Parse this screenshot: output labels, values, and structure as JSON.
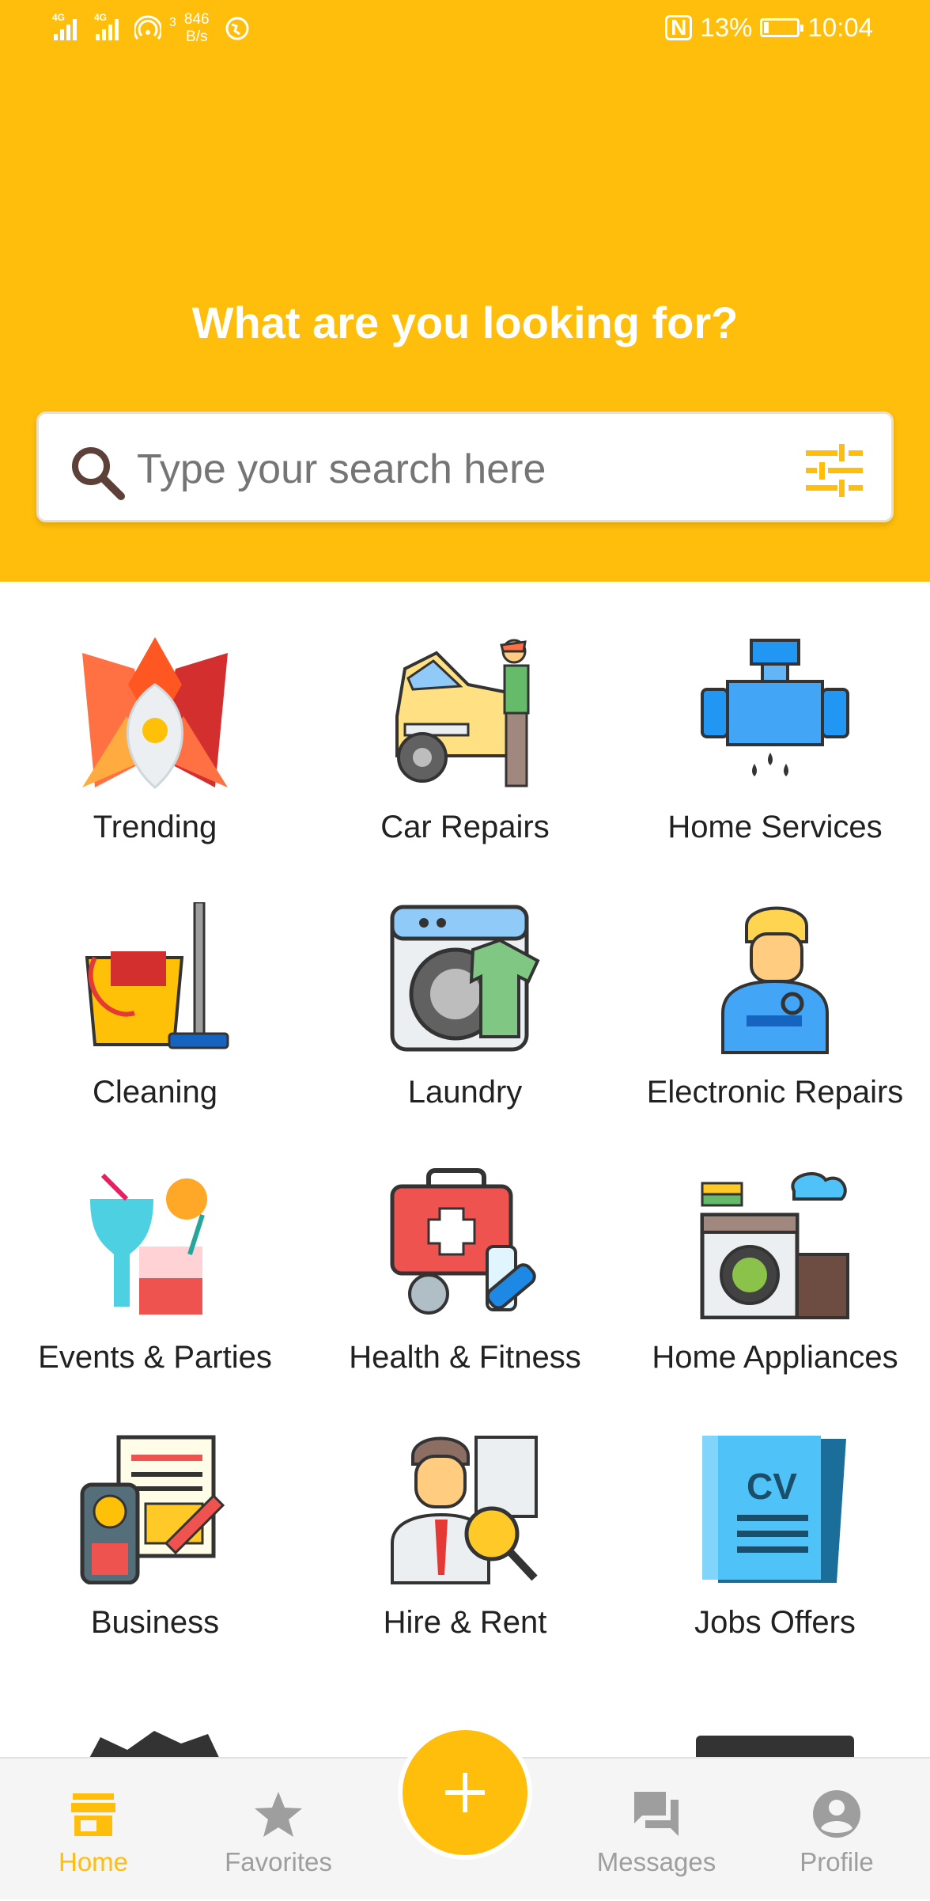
{
  "status_bar": {
    "network_1": "4G",
    "network_2": "4G",
    "hotspot_count": "3",
    "speed_value": "846",
    "speed_unit": "B/s",
    "battery": "13%",
    "time": "10:04",
    "icons": [
      "signal-icon",
      "signal-icon",
      "hotspot-icon",
      "vpn-icon",
      "nfc-icon",
      "battery-charging-icon"
    ]
  },
  "header": {
    "title": "What are you looking for?",
    "search_placeholder": "Type your search here",
    "search_icon": "search-icon",
    "filter_icon": "filter-sliders-icon"
  },
  "categories": [
    {
      "label": "Trending",
      "icon": "trending-flower-icon"
    },
    {
      "label": "Car Repairs",
      "icon": "car-repair-icon"
    },
    {
      "label": "Home Services",
      "icon": "plumbing-pipe-icon"
    },
    {
      "label": "Cleaning",
      "icon": "bucket-mop-icon"
    },
    {
      "label": "Laundry",
      "icon": "washing-machine-icon"
    },
    {
      "label": "Electronic Repairs",
      "icon": "technician-icon"
    },
    {
      "label": "Events & Parties",
      "icon": "cocktail-icon"
    },
    {
      "label": "Health & Fitness",
      "icon": "first-aid-kit-icon"
    },
    {
      "label": "Home Appliances",
      "icon": "appliances-icon"
    },
    {
      "label": "Business",
      "icon": "business-invoice-icon"
    },
    {
      "label": "Hire & Rent",
      "icon": "hire-person-icon"
    },
    {
      "label": "Jobs Offers",
      "icon": "cv-document-icon"
    }
  ],
  "bottom_nav": {
    "items": [
      {
        "label": "Home",
        "icon": "store-icon",
        "active": true
      },
      {
        "label": "Favorites",
        "icon": "star-icon",
        "active": false
      },
      {
        "label": "Messages",
        "icon": "chat-icon",
        "active": false
      },
      {
        "label": "Profile",
        "icon": "account-circle-icon",
        "active": false
      }
    ],
    "fab_icon": "plus-icon"
  },
  "colors": {
    "accent": "#FFBE0B",
    "inactive": "#9E9E9E",
    "text": "#212121"
  }
}
